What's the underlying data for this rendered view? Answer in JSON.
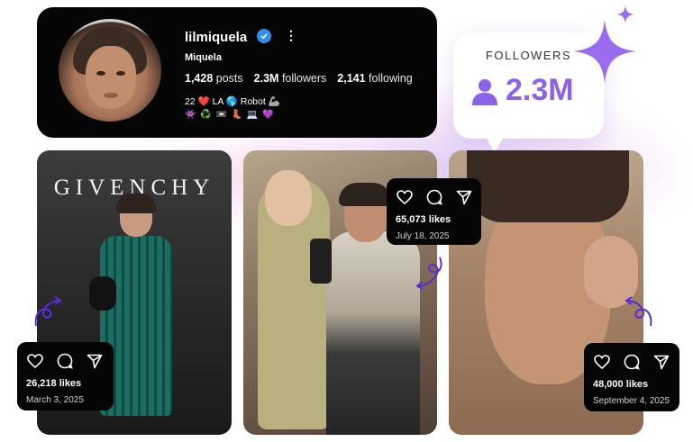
{
  "profile": {
    "username": "lilmiquela",
    "display_name": "Miquela",
    "more": "⋮",
    "posts_count": "1,428",
    "posts_label": "posts",
    "followers_count": "2.3M",
    "followers_label": "followers",
    "following_count": "2,141",
    "following_label": "following",
    "bio_line1": "22 ❤️ LA 🌎 Robot 🦾",
    "bio_line2": "👾 ♻️ 📼 👢 💻 💜"
  },
  "followers_bubble": {
    "label": "FOLLOWERS",
    "value": "2.3M"
  },
  "photos": [
    {
      "brand": "GIVENCHY"
    },
    {},
    {}
  ],
  "posts": [
    {
      "likes": "26,218 likes",
      "date": "March 3, 2025"
    },
    {
      "likes": "65,073 likes",
      "date": "July 18, 2025"
    },
    {
      "likes": "48,000 likes",
      "date": "September 4, 2025"
    }
  ],
  "colors": {
    "accent": "#8a63e8",
    "verified": "#2f8ff0",
    "card": "#050505"
  }
}
